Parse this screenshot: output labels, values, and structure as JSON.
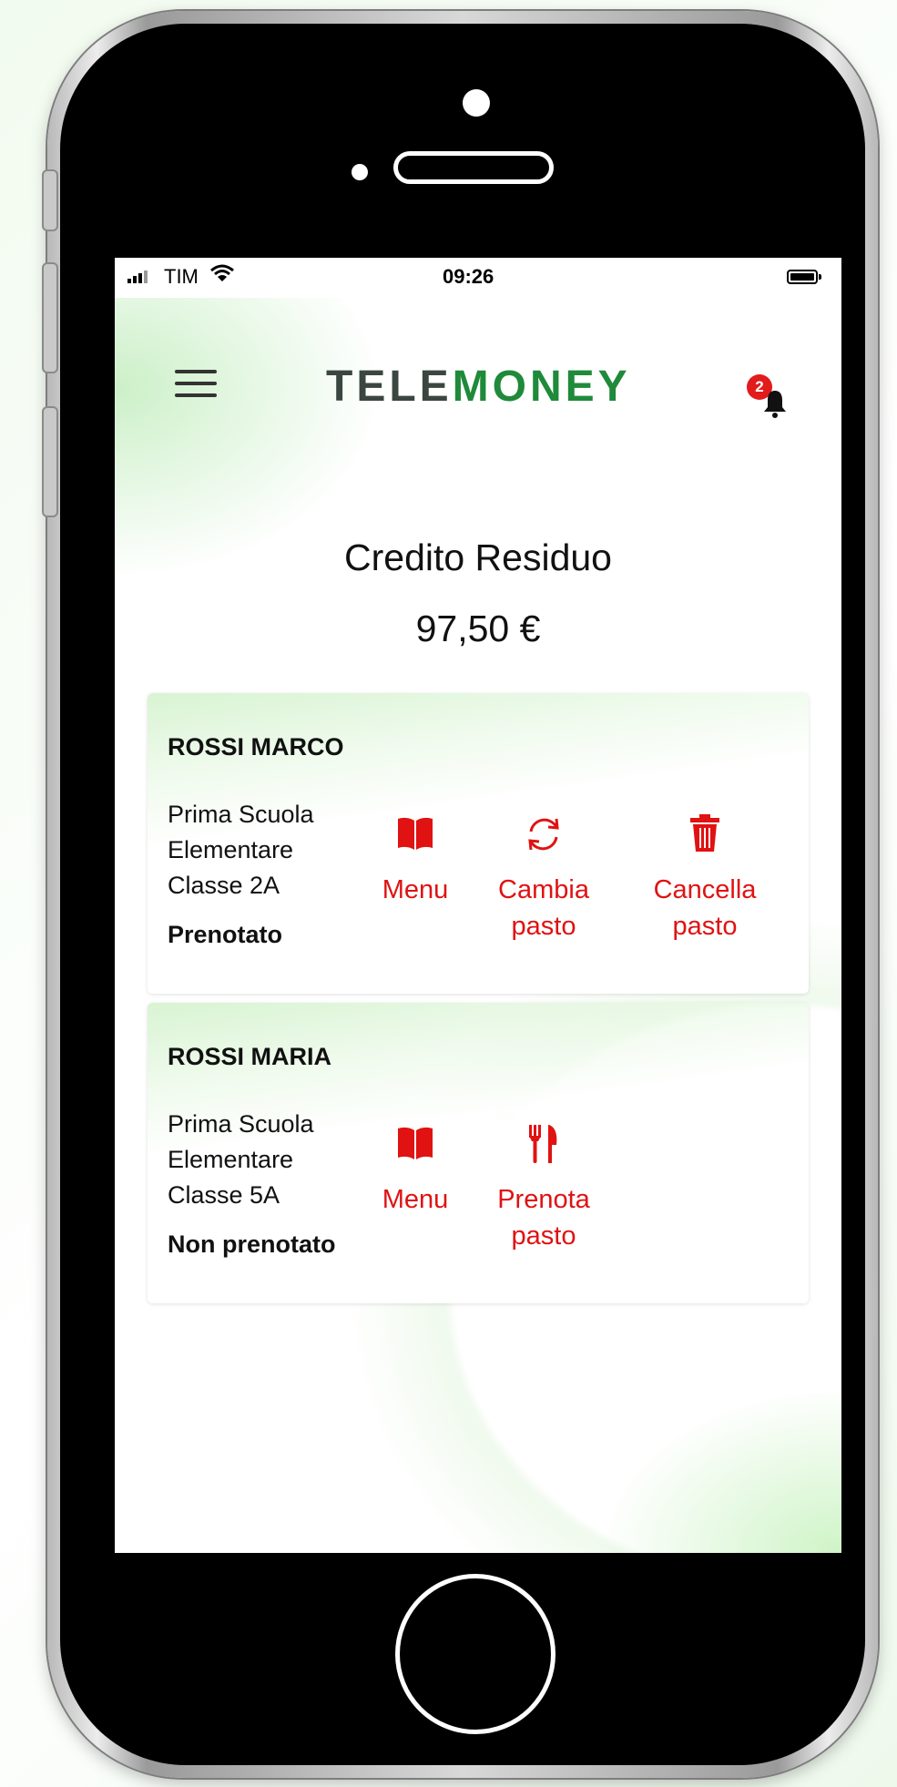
{
  "status_bar": {
    "carrier": "TIM",
    "time": "09:26"
  },
  "header": {
    "logo_part1": "TELE",
    "logo_part2": "MONEY",
    "notification_count": "2"
  },
  "credit": {
    "label": "Credito Residuo",
    "amount": "97,50 €"
  },
  "children": [
    {
      "name": "ROSSI MARCO",
      "school_line1": "Prima Scuola",
      "school_line2": "Elementare",
      "class": "Classe 2A",
      "status": "Prenotato",
      "actions": [
        {
          "icon": "book-icon",
          "label": "Menu"
        },
        {
          "icon": "refresh-icon",
          "label": "Cambia\npasto"
        },
        {
          "icon": "trash-icon",
          "label": "Cancella\npasto"
        }
      ]
    },
    {
      "name": "ROSSI MARIA",
      "school_line1": "Prima Scuola",
      "school_line2": "Elementare",
      "class": "Classe 5A",
      "status": "Non prenotato",
      "actions": [
        {
          "icon": "book-icon",
          "label": "Menu"
        },
        {
          "icon": "cutlery-icon",
          "label": "Prenota\npasto"
        }
      ]
    }
  ],
  "colors": {
    "accent_red": "#e01212",
    "brand_green": "#1f8a3a",
    "brand_dark": "#3b4640"
  }
}
